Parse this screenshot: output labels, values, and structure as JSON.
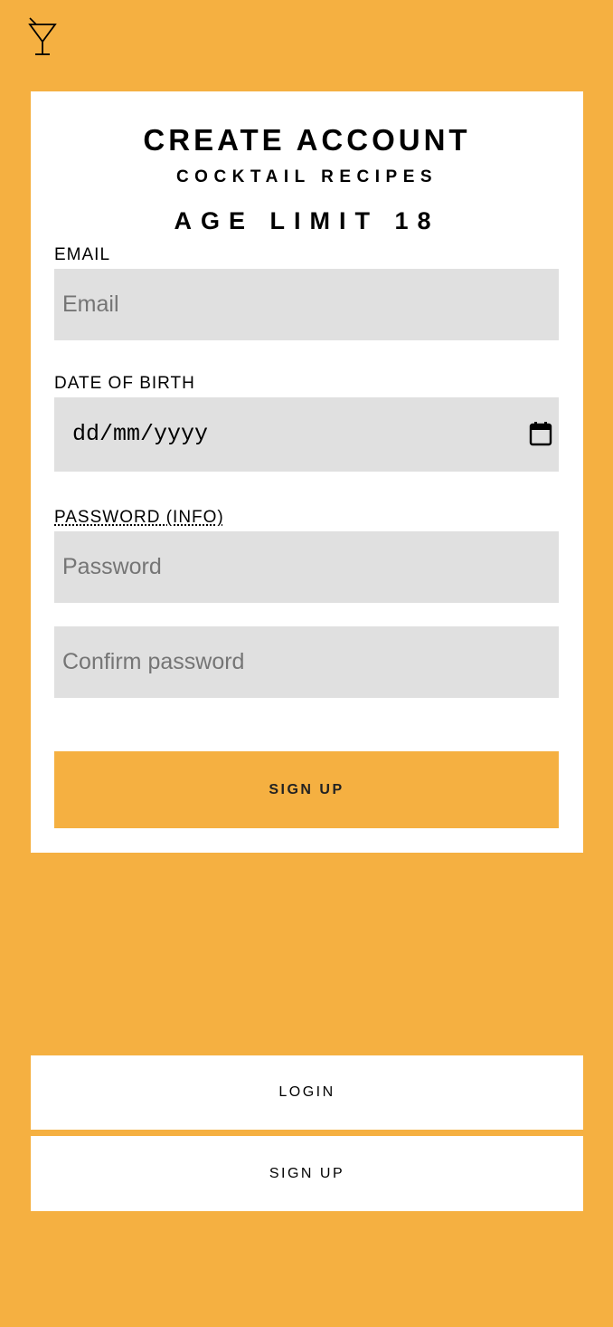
{
  "app": {
    "logo_icon": "cocktail-glass-icon",
    "accent_color": "#F5B041"
  },
  "form": {
    "title": "CREATE ACCOUNT",
    "subtitle": "COCKTAIL RECIPES",
    "age_notice": "AGE LIMIT 18",
    "email": {
      "label": "EMAIL",
      "placeholder": "Email",
      "value": ""
    },
    "dob": {
      "label": "DATE OF BIRTH",
      "placeholder": "dd/mm/yyyy",
      "icon": "calendar-icon"
    },
    "password": {
      "label": "PASSWORD (INFO)",
      "placeholder": "Password",
      "value": ""
    },
    "confirm_password": {
      "placeholder": "Confirm password",
      "value": ""
    },
    "submit_label": "SIGN UP"
  },
  "nav": {
    "login_label": "LOGIN",
    "signup_label": "SIGN UP"
  }
}
